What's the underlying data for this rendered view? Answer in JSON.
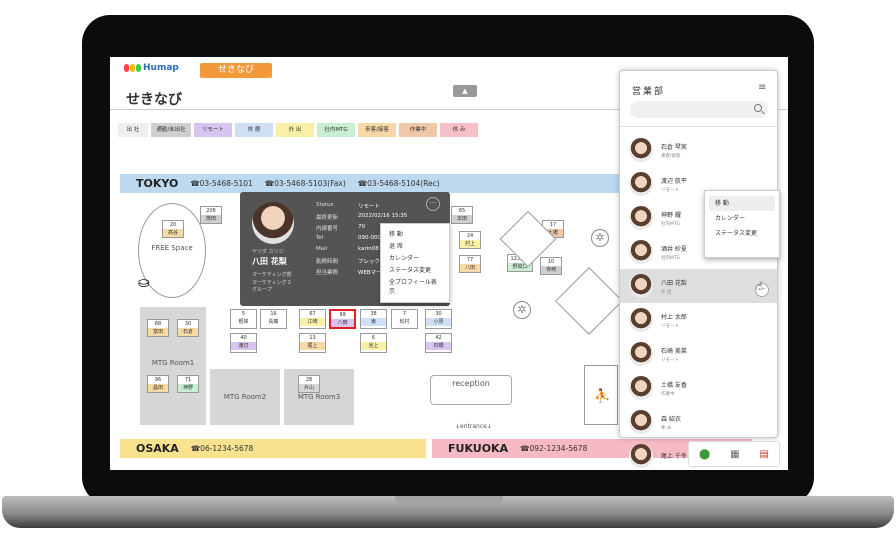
{
  "header": {
    "logo": "Humap",
    "active_tab": "せきなび",
    "title": "せきなび",
    "collapse_icon": "▲"
  },
  "legend": [
    {
      "label": "出 社",
      "color": "#eeeeee"
    },
    {
      "label": "通勤/未出社",
      "color": "#cfcfcf"
    },
    {
      "label": "リモート",
      "color": "#d7c4ef"
    },
    {
      "label": "休 憩",
      "color": "#cfe0f5"
    },
    {
      "label": "外 出",
      "color": "#f7f0a6"
    },
    {
      "label": "社内MTG",
      "color": "#c9eed1"
    },
    {
      "label": "来客/接客",
      "color": "#f7d9a6"
    },
    {
      "label": "作業中",
      "color": "#f0c8a8"
    },
    {
      "label": "休 み",
      "color": "#f6c0c8"
    }
  ],
  "zones": {
    "tokyo": {
      "name": "TOKYO",
      "tel1": "☎03-5468-5101",
      "tel2": "☎03-5468-5103(Fax)",
      "tel3": "☎03-5468-5104(Rec)"
    },
    "osaka": {
      "name": "OSAKA",
      "tel": "☎06-1234-5678"
    },
    "fukuoka": {
      "name": "FUKUOKA",
      "tel": "☎092-1234-5678"
    }
  },
  "rooms": {
    "free_space": "FREE Space",
    "mtg1": "MTG Room1",
    "mtg2": "MTG Room2",
    "mtg3": "MTG Room3",
    "reception": "reception",
    "entrance": "↓entrance↓"
  },
  "desks": [
    {
      "no": "20",
      "name": "高谷",
      "color": "#f7d9a6"
    },
    {
      "no": "206",
      "name": "熊田",
      "color": "#cfcfcf"
    },
    {
      "no": "68",
      "name": "富田",
      "color": "#f7d9a6"
    },
    {
      "no": "30",
      "name": "石倉",
      "color": "#f7d9a6"
    },
    {
      "no": "96",
      "name": "昌田",
      "color": "#f7d9a6"
    },
    {
      "no": "71",
      "name": "神野",
      "color": "#c9eed1"
    },
    {
      "no": "5",
      "name": "根岸",
      "color": "#ffffff"
    },
    {
      "no": "16",
      "name": "長藤",
      "color": "#ffffff"
    },
    {
      "no": "67",
      "name": "江崎",
      "color": "#f7f0a6"
    },
    {
      "no": "99",
      "name": "八田",
      "color": "#d7c4ef"
    },
    {
      "no": "38",
      "name": "東",
      "color": "#cfe0f5"
    },
    {
      "no": "7",
      "name": "松村",
      "color": "#ffffff"
    },
    {
      "no": "30",
      "name": "小原",
      "color": "#cfe0f5"
    },
    {
      "no": "40",
      "name": "渡辺",
      "color": "#d7c4ef"
    },
    {
      "no": "13",
      "name": "尾上",
      "color": "#f7d9a6"
    },
    {
      "no": "6",
      "name": "池上",
      "color": "#f7f0a6"
    },
    {
      "no": "42",
      "name": "石橋",
      "color": "#d7c4ef"
    },
    {
      "no": "28",
      "name": "片山",
      "color": "#d6d6d6"
    },
    {
      "no": "65",
      "name": "本田",
      "color": "#cfcfcf"
    },
    {
      "no": "24",
      "name": "村上",
      "color": "#f7f0a6"
    },
    {
      "no": "77",
      "name": "八田",
      "color": "#f7d9a6"
    },
    {
      "no": "10",
      "name": "寺崎",
      "color": "#cfcfcf"
    },
    {
      "no": "17",
      "name": "土橋",
      "color": "#f0c8a8"
    },
    {
      "no": "123456",
      "name": "野間口",
      "color": "#c9eed1"
    },
    {
      "no": "97",
      "name": "寺崎",
      "color": "#ffffff"
    },
    {
      "no": "8",
      "name": "砂川",
      "color": "#f7f0a6"
    },
    {
      "no": "43",
      "name": "酒井",
      "color": "#c9eed1"
    }
  ],
  "profile_card": {
    "kana": "ヤツダ カツジ",
    "name": "八田 花梨",
    "dept1": "マーケティング部",
    "dept2": "マーケティング２",
    "dept3": "グループ",
    "fields": [
      {
        "label": "Status",
        "value": "リモート"
      },
      {
        "label": "最終更新",
        "value": "2022/02/16 15:35"
      },
      {
        "label": "内線番号",
        "value": "70"
      },
      {
        "label": "Tel",
        "value": "090-0000"
      },
      {
        "label": "Mail",
        "value": "karin087"
      },
      {
        "label": "勤務時間",
        "value": "フレック タイム制"
      },
      {
        "label": "担当業務",
        "value": "WEBマー 「HP更 いわゆ 担当"
      }
    ],
    "more_icon": "···"
  },
  "card_menu": [
    "移 動",
    "退 席",
    "カレンダー",
    "ステータス変更",
    "全プロフィール表示"
  ],
  "panel": {
    "title": "営業部",
    "menu_icon": "≡",
    "search_placeholder": "",
    "members": [
      {
        "name": "石倉 琴実",
        "status": "来客/接客"
      },
      {
        "name": "渡辺 航平",
        "status": "リモート"
      },
      {
        "name": "神野 耀",
        "status": "社内MTG"
      },
      {
        "name": "酒井 紗夏",
        "status": "社内MTG"
      },
      {
        "name": "八田 花梨",
        "status": "外 出"
      },
      {
        "name": "村上 太郎",
        "status": "リモート"
      },
      {
        "name": "石崎 美菜",
        "status": "リモート"
      },
      {
        "name": "土橋 友香",
        "status": "作業中"
      },
      {
        "name": "森 紹衣",
        "status": "休 み"
      },
      {
        "name": "尾上 千冬",
        "status": ""
      }
    ],
    "more_icon": "···"
  },
  "member_menu": [
    "移 動",
    "カレンダー",
    "ステータス変更"
  ],
  "bottom_icons": [
    "map-pin-icon",
    "calculator-icon",
    "calendar-icon"
  ]
}
